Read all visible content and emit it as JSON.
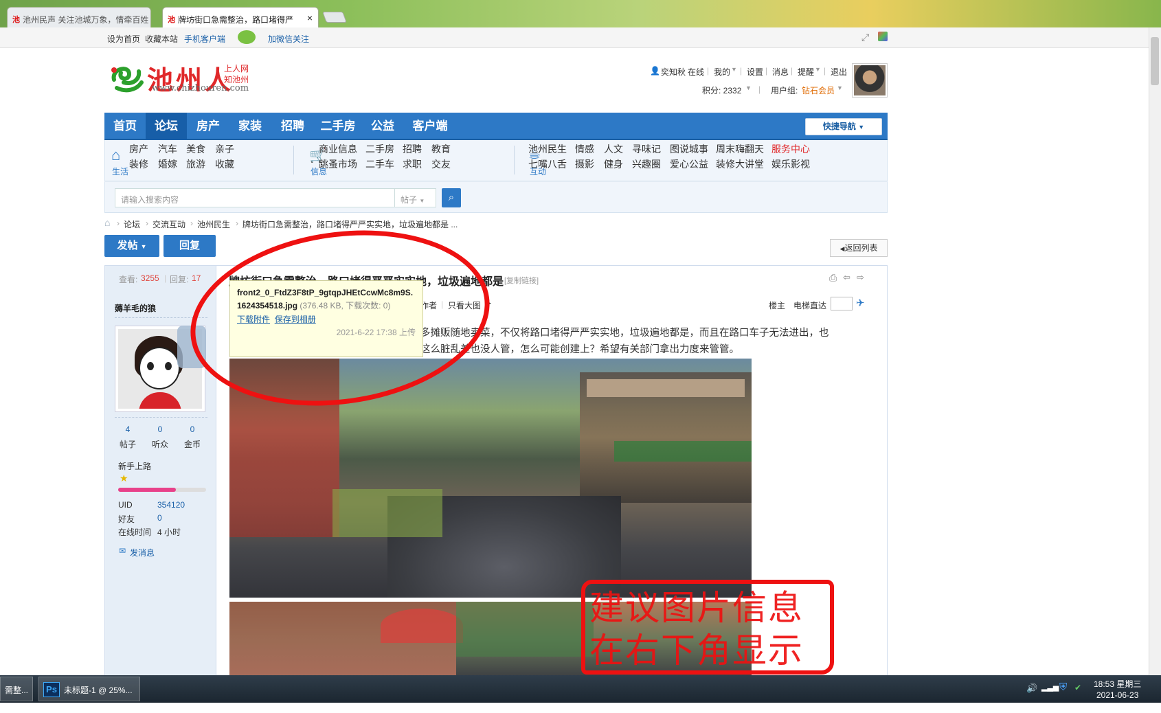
{
  "browser": {
    "tab1_title": "池州民声 关注池城万象，情牵百姓",
    "tab2_title": "牌坊街口急需整治，路口堵得严",
    "tab_close": "×"
  },
  "topbar": {
    "set_home": "设为首页",
    "bookmark": "收藏本站",
    "mobile_client": "手机客户端",
    "wechat_follow": "加微信关注"
  },
  "logo": {
    "mark": "池州人",
    "tagline1": "上人网",
    "tagline2": "知池州",
    "url": "www.chizhouren.com"
  },
  "user": {
    "name": "奕知秋",
    "online": "在线",
    "my": "我的",
    "settings": "设置",
    "messages": "消息",
    "reminders": "提醒",
    "logout": "退出",
    "points_label": "积分: 2332",
    "group_label": "用户组:",
    "group_value": "钻石会员"
  },
  "nav": {
    "items": [
      "首页",
      "论坛",
      "房产",
      "家装",
      "招聘",
      "二手房",
      "公益",
      "客户端"
    ],
    "active": "论坛",
    "quick_nav": "快捷导航"
  },
  "subnav": {
    "life_cap": "生活",
    "life_row1": [
      "房产",
      "汽车",
      "美食",
      "亲子"
    ],
    "life_row2": [
      "装修",
      "婚嫁",
      "旅游",
      "收藏"
    ],
    "info_cap": "信息",
    "info_row1": [
      "商业信息",
      "二手房",
      "招聘",
      "教育"
    ],
    "info_row2": [
      "跳蚤市场",
      "二手车",
      "求职",
      "交友"
    ],
    "interact_cap": "互动",
    "interact_row1": [
      "池州民生",
      "情感",
      "人文",
      "寻味记",
      "图说城事",
      "周末嗨翻天",
      "服务中心"
    ],
    "interact_row2": [
      "七嘴八舌",
      "摄影",
      "健身",
      "兴趣圈",
      "爱心公益",
      "装修大讲堂",
      "娱乐影视"
    ]
  },
  "search": {
    "placeholder": "请输入搜索内容",
    "type": "帖子"
  },
  "breadcrumb": [
    "论坛",
    "交流互动",
    "池州民生",
    "牌坊街口急需整治，路口堵得严严实实地，垃圾遍地都是 ..."
  ],
  "actions": {
    "post": "发帖",
    "reply": "回复",
    "back_list": "返回列表"
  },
  "thread": {
    "views_label": "查看:",
    "views": "3255",
    "replies_label": "回复:",
    "replies": "17",
    "title": "牌坊街口急需整治，路口堵得严严实实地，垃圾遍地都是",
    "copy_link": "[复制链接]",
    "author_only": "作者",
    "big_image": "只看大图",
    "floor_label": "楼主",
    "elevator": "电梯直达",
    "body_line1": "多摊贩随地卖菜，不仅将路口堵得严严实实地，垃圾遍地都是，而且在路口车子无法进出，也",
    "body_line2": "这么脏乱差也没人管，怎么可能创建上？希望有关部门拿出力度来管管。"
  },
  "author": {
    "name": "薅羊毛的狼",
    "posts": "4",
    "posts_label": "帖子",
    "listeners": "0",
    "listeners_label": "听众",
    "coins": "0",
    "coins_label": "金币",
    "rank": "新手上路",
    "uid_label": "UID",
    "uid": "354120",
    "friends_label": "好友",
    "friends": "0",
    "online_label": "在线时间",
    "online_time": "4 小时",
    "send_message": "发消息"
  },
  "attachment_tip": {
    "filename": "front2_0_FtdZ3F8tP_9gtqpJHEtCcwMc8m9S.1624354518.jpg",
    "meta": "(376.48 KB, 下载次数: 0)",
    "download": "下载附件",
    "save_album": "保存到相册",
    "uploaded": "2021-6-22 17:38 上传"
  },
  "annotation": {
    "line1": "建议图片信息",
    "line2": "在右下角显示"
  },
  "taskbar": {
    "item1": "需整...",
    "item2": "未标题-1 @ 25%...",
    "time": "18:53 星期三",
    "date": "2021-06-23"
  },
  "colors": {
    "nav_blue": "#2d79c6",
    "highlight_red": "#e11111",
    "link_blue": "#1a60a8"
  }
}
